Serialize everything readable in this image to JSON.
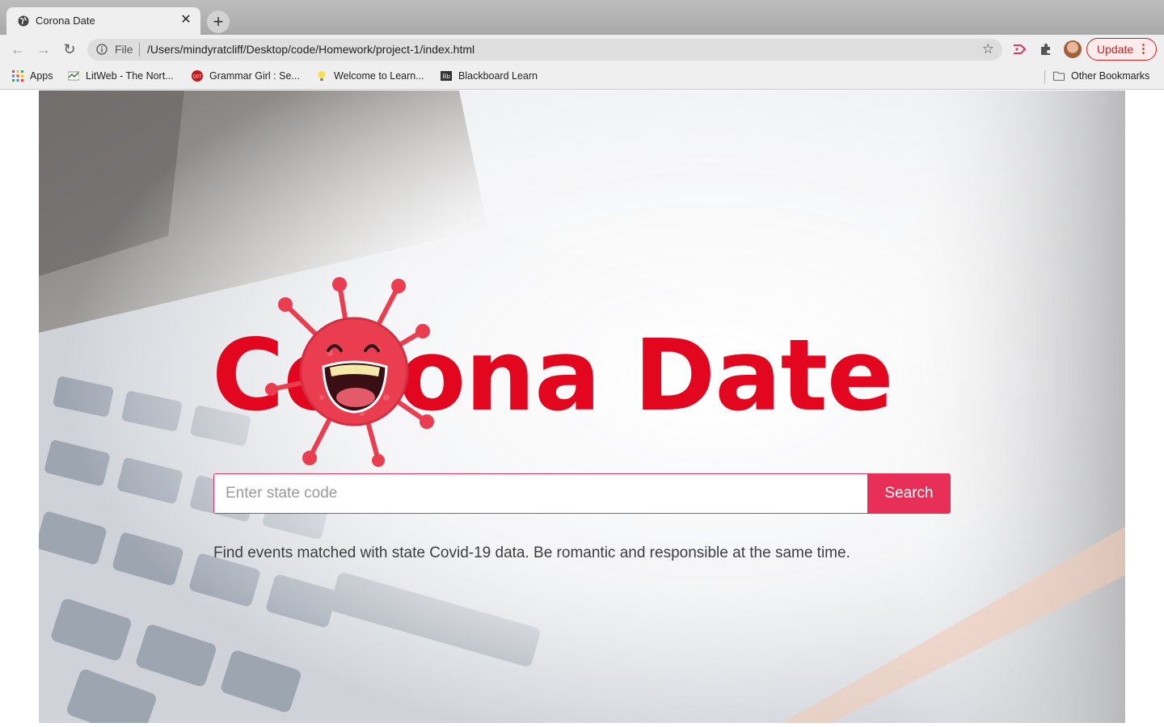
{
  "browser": {
    "tab_title": "Corona Date",
    "tab_close": "✕",
    "new_tab": "+",
    "scheme_label": "File",
    "url": "/Users/mindyratcliff/Desktop/code/Homework/project-1/index.html",
    "update_label": "Update",
    "menu_glyph": "⋮",
    "bookmarks": [
      {
        "label": "Apps",
        "icon": "apps-grid-icon"
      },
      {
        "label": "LitWeb - The Nort...",
        "icon": "litweb-icon"
      },
      {
        "label": "Grammar Girl : Se...",
        "icon": "grammar-girl-icon"
      },
      {
        "label": "Welcome to Learn...",
        "icon": "lightbulb-icon"
      },
      {
        "label": "Blackboard Learn",
        "icon": "blackboard-icon"
      }
    ],
    "other_bookmarks": "Other Bookmarks"
  },
  "page": {
    "logo_text": "Corona Date",
    "search_placeholder": "Enter state code",
    "search_value": "",
    "search_button": "Search",
    "tagline": "Find events matched with state Covid-19 data. Be romantic and responsible at the same time."
  },
  "colors": {
    "brand_red": "#e3061f",
    "button_red": "#e82f57",
    "update_red": "#c5221f"
  }
}
